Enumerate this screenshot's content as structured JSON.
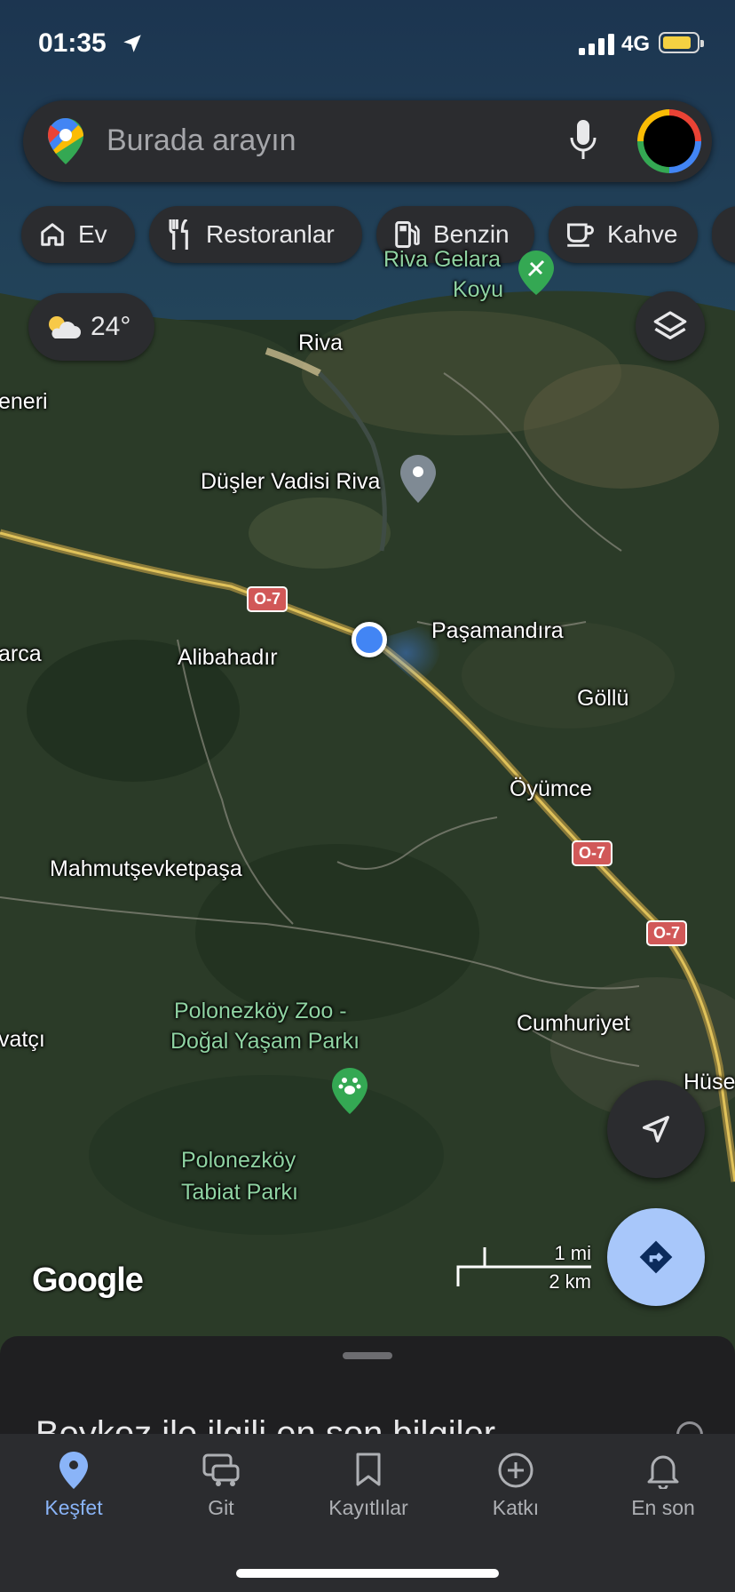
{
  "status_bar": {
    "time": "01:35",
    "network": "4G"
  },
  "search": {
    "placeholder": "Burada arayın"
  },
  "chips": [
    {
      "label": "Ev",
      "icon": "home-icon"
    },
    {
      "label": "Restoranlar",
      "icon": "restaurant-icon"
    },
    {
      "label": "Benzin",
      "icon": "gas-station-icon"
    },
    {
      "label": "Kahve",
      "icon": "coffee-icon"
    }
  ],
  "weather": {
    "temperature": "24°",
    "icon": "partly-cloudy-icon"
  },
  "map": {
    "places": [
      {
        "name": "Riva Gelara",
        "kind": "place"
      },
      {
        "name": "Koyu",
        "kind": "place"
      },
      {
        "name": "Riva",
        "kind": "place"
      },
      {
        "name": "eneri",
        "kind": "place"
      },
      {
        "name": "Düşler Vadisi Riva",
        "kind": "place"
      },
      {
        "name": "Paşamandıra",
        "kind": "place"
      },
      {
        "name": "arca",
        "kind": "place"
      },
      {
        "name": "Alibahadır",
        "kind": "place"
      },
      {
        "name": "Göllü",
        "kind": "place"
      },
      {
        "name": "Öyümce",
        "kind": "place"
      },
      {
        "name": "Mahmutşevketpaşa",
        "kind": "place"
      },
      {
        "name": "Polonezköy Zoo -",
        "kind": "park"
      },
      {
        "name": "Doğal Yaşam Parkı",
        "kind": "park"
      },
      {
        "name": "vatçı",
        "kind": "place"
      },
      {
        "name": "Cumhuriyet",
        "kind": "place"
      },
      {
        "name": "Hüse",
        "kind": "place"
      },
      {
        "name": "Polonezköy",
        "kind": "park"
      },
      {
        "name": "Tabiat Parkı",
        "kind": "park"
      }
    ],
    "road_shields": [
      "O-7",
      "O-7",
      "O-7"
    ],
    "watermark": "Google",
    "scale": {
      "imperial": "1 mi",
      "metric": "2 km"
    },
    "colors": {
      "user_location": "#4285f4",
      "road_shield": "#d15858",
      "park_pin": "#34a853"
    }
  },
  "sheet": {
    "title": "Beykoz ile ilgili en son bilgiler"
  },
  "tabs": [
    {
      "label": "Keşfet",
      "icon": "explore-pin-icon",
      "active": true
    },
    {
      "label": "Git",
      "icon": "car-icon",
      "active": false
    },
    {
      "label": "Kayıtlılar",
      "icon": "bookmark-icon",
      "active": false
    },
    {
      "label": "Katkı",
      "icon": "plus-circle-icon",
      "active": false
    },
    {
      "label": "En son",
      "icon": "bell-icon",
      "active": false
    }
  ]
}
